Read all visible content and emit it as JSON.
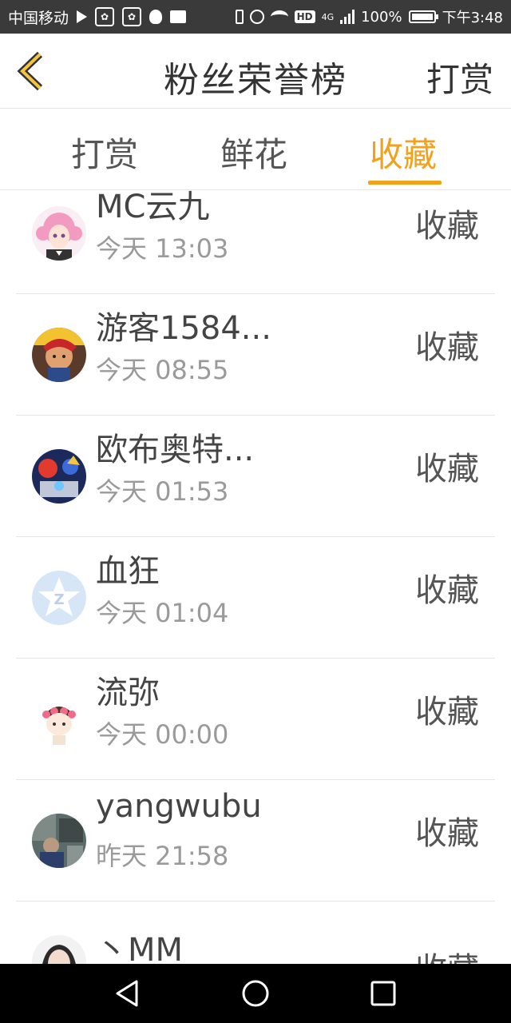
{
  "status_bar": {
    "carrier": "中国移动",
    "network": "4G",
    "hd": "HD",
    "battery": "100%",
    "time": "下午3:48"
  },
  "header": {
    "back_icon": "chevron-left-icon",
    "title": "粉丝荣誉榜",
    "action": "打赏"
  },
  "tabs": [
    {
      "label": "打赏",
      "active": false
    },
    {
      "label": "鲜花",
      "active": false
    },
    {
      "label": "收藏",
      "active": true
    }
  ],
  "accent_color": "#f4a11a",
  "list": [
    {
      "name": "MC云九",
      "time": "今天 13:03",
      "action": "收藏",
      "avatar": "anime-girl-avatar"
    },
    {
      "name": "游客1584...",
      "time": "今天 08:55",
      "action": "收藏",
      "avatar": "game-character-avatar"
    },
    {
      "name": "欧布奥特...",
      "time": "今天 01:53",
      "action": "收藏",
      "avatar": "ultraman-avatar"
    },
    {
      "name": "血狂",
      "time": "今天 01:04",
      "action": "收藏",
      "avatar": "default-z-avatar"
    },
    {
      "name": "流弥",
      "time": "今天 00:00",
      "action": "收藏",
      "avatar": "cartoon-girl-avatar"
    },
    {
      "name": "yangwubu",
      "time": "昨天 21:58",
      "action": "收藏",
      "avatar": "photo-avatar"
    },
    {
      "name": "丶MM",
      "time": "",
      "action": "收藏",
      "avatar": "woman-photo-avatar"
    }
  ],
  "nav_bar": {
    "back": "nav-back-icon",
    "home": "nav-home-icon",
    "recents": "nav-recents-icon"
  }
}
